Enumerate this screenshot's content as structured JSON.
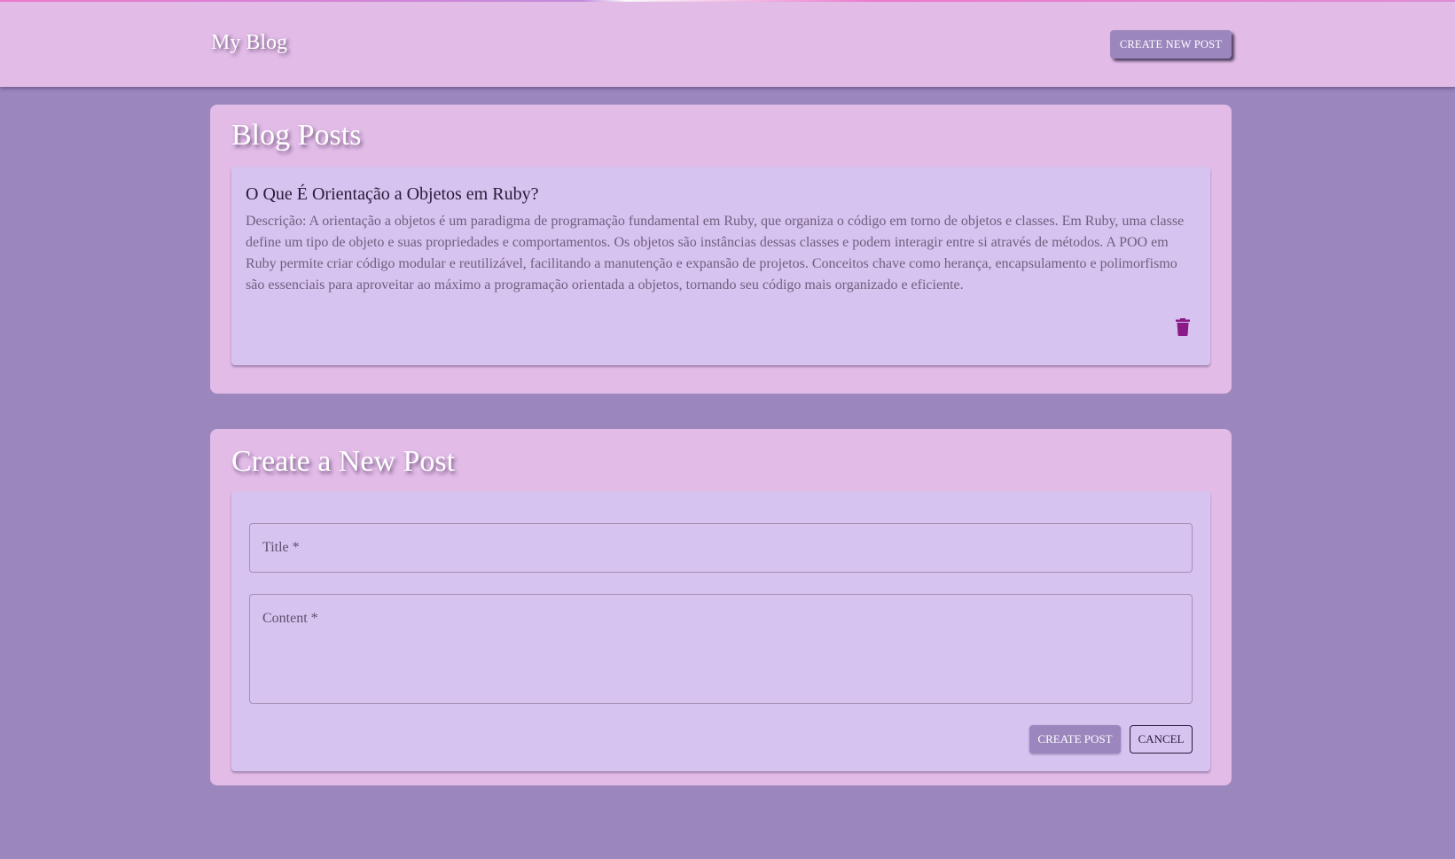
{
  "app": {
    "brand": "My Blog",
    "create_new_post_label": "CREATE NEW POST"
  },
  "posts_section": {
    "title": "Blog Posts",
    "posts": [
      {
        "title": "O Que É Orientação a Objetos em Ruby?",
        "description": "Descrição: A orientação a objetos é um paradigma de programação fundamental em Ruby, que organiza o código em torno de objetos e classes. Em Ruby, uma classe define um tipo de objeto e suas propriedades e comportamentos. Os objetos são instâncias dessas classes e podem interagir entre si através de métodos. A POO em Ruby permite criar código modular e reutilizável, facilitando a manutenção e expansão de projetos. Conceitos chave como herança, encapsulamento e polimorfismo são essenciais para aproveitar ao máximo a programação orientada a objetos, tornando seu código mais organizado e eficiente.",
        "delete_icon": "trash-icon"
      }
    ]
  },
  "form_section": {
    "title": "Create a New Post",
    "title_field": {
      "label": "Title *",
      "value": ""
    },
    "content_field": {
      "label": "Content *",
      "value": ""
    },
    "create_label": "CREATE POST",
    "cancel_label": "CANCEL"
  },
  "colors": {
    "background": "#9b87bd",
    "panel": "#e2bbe7",
    "card": "#d7c3ef",
    "accent": "#9b87bd",
    "delete_icon": "#8a1a88"
  }
}
